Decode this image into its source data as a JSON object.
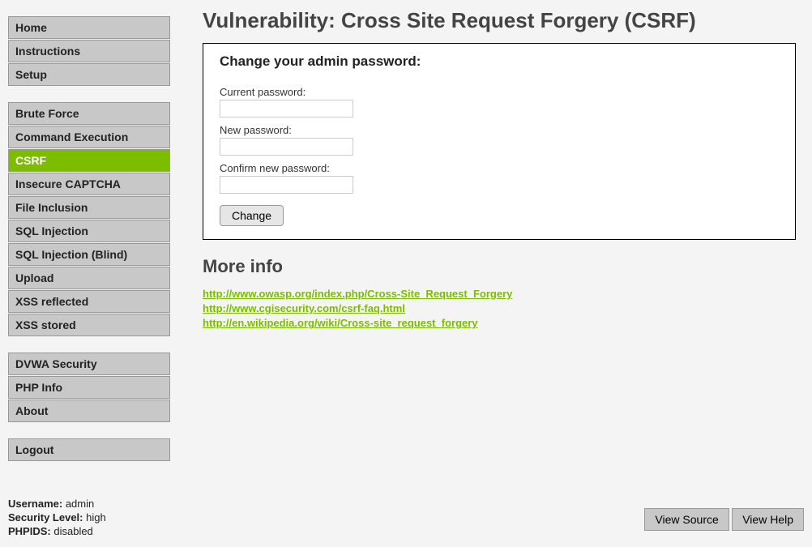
{
  "sidebar": {
    "groups": [
      {
        "items": [
          {
            "label": "Home",
            "active": false
          },
          {
            "label": "Instructions",
            "active": false
          },
          {
            "label": "Setup",
            "active": false
          }
        ]
      },
      {
        "items": [
          {
            "label": "Brute Force",
            "active": false
          },
          {
            "label": "Command Execution",
            "active": false
          },
          {
            "label": "CSRF",
            "active": true
          },
          {
            "label": "Insecure CAPTCHA",
            "active": false
          },
          {
            "label": "File Inclusion",
            "active": false
          },
          {
            "label": "SQL Injection",
            "active": false
          },
          {
            "label": "SQL Injection (Blind)",
            "active": false
          },
          {
            "label": "Upload",
            "active": false
          },
          {
            "label": "XSS reflected",
            "active": false
          },
          {
            "label": "XSS stored",
            "active": false
          }
        ]
      },
      {
        "items": [
          {
            "label": "DVWA Security",
            "active": false
          },
          {
            "label": "PHP Info",
            "active": false
          },
          {
            "label": "About",
            "active": false
          }
        ]
      },
      {
        "items": [
          {
            "label": "Logout",
            "active": false
          }
        ]
      }
    ]
  },
  "main": {
    "page_title": "Vulnerability: Cross Site Request Forgery (CSRF)",
    "form": {
      "title": "Change your admin password:",
      "current_password_label": "Current password:",
      "current_password_value": "",
      "new_password_label": "New password:",
      "new_password_value": "",
      "confirm_password_label": "Confirm new password:",
      "confirm_password_value": "",
      "submit_label": "Change"
    },
    "more_info_title": "More info",
    "links": [
      "http://www.owasp.org/index.php/Cross-Site_Request_Forgery",
      "http://www.cgisecurity.com/csrf-faq.html",
      "http://en.wikipedia.org/wiki/Cross-site_request_forgery"
    ]
  },
  "footer": {
    "username_label": "Username:",
    "username_value": "admin",
    "security_label": "Security Level:",
    "security_value": "high",
    "phpids_label": "PHPIDS:",
    "phpids_value": "disabled",
    "view_source_label": "View Source",
    "view_help_label": "View Help"
  }
}
